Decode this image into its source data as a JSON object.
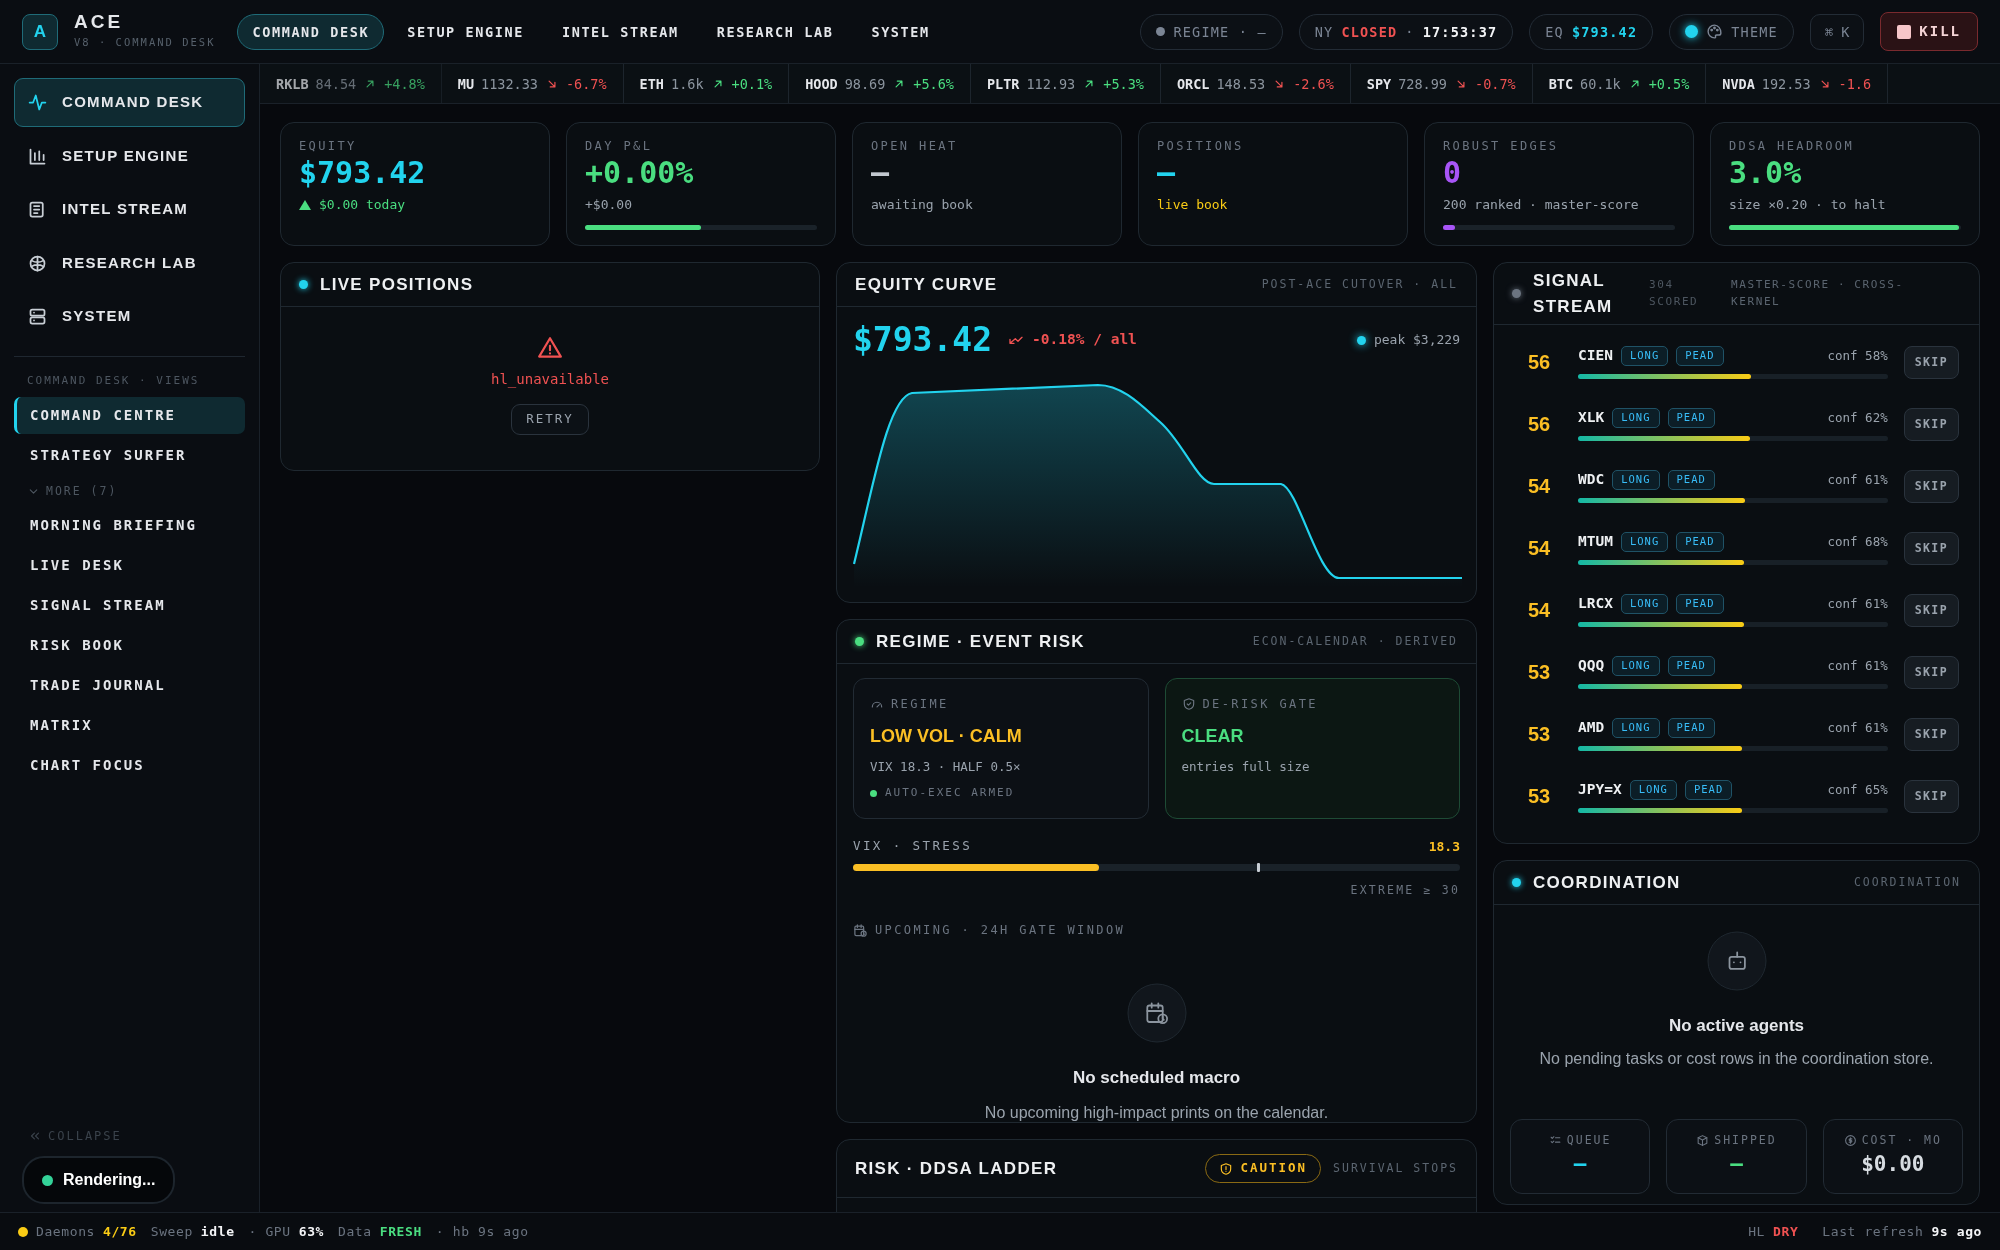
{
  "brand": {
    "logo": "A",
    "name": "ACE",
    "subtitle": "V8 · COMMAND DESK"
  },
  "top_nav": [
    {
      "label": "COMMAND DESK",
      "selected": true
    },
    {
      "label": "SETUP ENGINE",
      "selected": false
    },
    {
      "label": "INTEL STREAM",
      "selected": false
    },
    {
      "label": "RESEARCH LAB",
      "selected": false
    },
    {
      "label": "SYSTEM",
      "selected": false
    }
  ],
  "top_status": {
    "regime": {
      "label": "REGIME · —",
      "color": "#7b8594"
    },
    "market": {
      "city": "NY",
      "session": "CLOSED",
      "separator": "·",
      "time": "17:53:37"
    },
    "equity": {
      "label": "EQ",
      "value": "$793.42"
    },
    "theme": {
      "label": "THEME",
      "color": "#22d3ee"
    },
    "shortcut": {
      "label": "⌘ K"
    },
    "kill": {
      "label": "KILL"
    }
  },
  "ticker": [
    {
      "symbol": "RKLB",
      "price": "84.54",
      "change": "+4.8%",
      "rising": true
    },
    {
      "symbol": "MU",
      "price": "1132.33",
      "change": "-6.7%",
      "rising": false
    },
    {
      "symbol": "ETH",
      "price": "1.6k",
      "change": "+0.1%",
      "rising": true
    },
    {
      "symbol": "HOOD",
      "price": "98.69",
      "change": "+5.6%",
      "rising": true
    },
    {
      "symbol": "PLTR",
      "price": "112.93",
      "change": "+5.3%",
      "rising": true
    },
    {
      "symbol": "ORCL",
      "price": "148.53",
      "change": "-2.6%",
      "rising": false
    },
    {
      "symbol": "SPY",
      "price": "728.99",
      "change": "-0.7%",
      "rising": false
    },
    {
      "symbol": "BTC",
      "price": "60.1k",
      "change": "+0.5%",
      "rising": true
    },
    {
      "symbol": "NVDA",
      "price": "192.53",
      "change": "-1.6",
      "rising": false
    }
  ],
  "sidebar": {
    "items": [
      {
        "label": "COMMAND DESK",
        "selected": true
      },
      {
        "label": "SETUP ENGINE",
        "selected": false
      },
      {
        "label": "INTEL STREAM",
        "selected": false
      },
      {
        "label": "RESEARCH LAB",
        "selected": false
      },
      {
        "label": "SYSTEM",
        "selected": false
      }
    ],
    "views_heading": "COMMAND DESK · VIEWS",
    "views": [
      {
        "label": "COMMAND CENTRE",
        "selected": true
      },
      {
        "label": "STRATEGY SURFER",
        "selected": false
      }
    ],
    "more": {
      "label": "MORE (7)",
      "expanded": true,
      "items": [
        {
          "label": "MORNING BRIEFING",
          "selected": false
        },
        {
          "label": "LIVE DESK",
          "selected": false
        },
        {
          "label": "SIGNAL STREAM",
          "selected": false
        },
        {
          "label": "RISK BOOK",
          "selected": false
        },
        {
          "label": "TRADE JOURNAL",
          "selected": false
        },
        {
          "label": "MATRIX",
          "selected": false
        },
        {
          "label": "CHART FOCUS",
          "selected": false
        }
      ]
    },
    "collapse": "COLLAPSE"
  },
  "toast": {
    "label": "Rendering...",
    "color": "#34d399"
  },
  "kpis": [
    {
      "label": "EQUITY",
      "value": "$793.42",
      "color": "#22d3ee",
      "rising": true,
      "sub": {
        "text": "$0.00 today",
        "color": "#4ade80"
      }
    },
    {
      "label": "DAY P&L",
      "value": "+0.00%",
      "color": "#4ade80",
      "sub": {
        "text": "+$0.00",
        "color": "#9aa3ad"
      },
      "level": 0.5
    },
    {
      "label": "OPEN HEAT",
      "value": "—",
      "color": "#c2c8cf",
      "sub": {
        "text": "awaiting book",
        "color": "#9aa3ad"
      }
    },
    {
      "label": "POSITIONS",
      "value": "—",
      "color": "#22d3ee",
      "sub": {
        "text": "live book",
        "color": "#facc15"
      }
    },
    {
      "label": "ROBUST EDGES",
      "value": "0",
      "color": "#a855f7",
      "sub": {
        "text": "200 ranked · master-score",
        "color": "#9aa3ad"
      },
      "level": 0.05
    },
    {
      "label": "DDSA HEADROOM",
      "value": "3.0%",
      "color": "#4ade80",
      "sub": {
        "text": "size ×0.20 · to halt",
        "color": "#9aa3ad"
      },
      "level": 0.99
    }
  ],
  "live_positions": {
    "title": "LIVE POSITIONS",
    "color": "#22d3ee",
    "error": "hl_unavailable",
    "action": "RETRY"
  },
  "equity_curve": {
    "title": "EQUITY CURVE",
    "meta": "POST-ACE CUTOVER · ALL",
    "value": "$793.42",
    "change": "-0.18% / all",
    "peak": "peak $3,229"
  },
  "regime_panel": {
    "title": "REGIME · EVENT RISK",
    "color": "#4ade80",
    "meta": "ECON-CALENDAR · DERIVED",
    "regime": {
      "label": "REGIME",
      "value": "LOW VOL · CALM",
      "detail": "VIX 18.3 · HALF 0.5×",
      "armed": "AUTO-EXEC ARMED"
    },
    "gate": {
      "label": "DE-RISK GATE",
      "value": "CLEAR",
      "detail": "entries full size"
    },
    "vix": {
      "label": "VIX · STRESS",
      "value": "18.3",
      "level": 0.405,
      "threshold": "EXTREME ≥ 30"
    },
    "upcoming": {
      "label": "UPCOMING · 24H GATE WINDOW",
      "empty_title": "No scheduled macro",
      "empty_text": "No upcoming high-impact prints on the calendar."
    }
  },
  "risk_panel": {
    "title": "RISK · DDSA LADDER",
    "badge": "CAUTION",
    "meta": "SURVIVAL STOPS"
  },
  "signal_stream": {
    "title": "SIGNAL STREAM",
    "color": "#6b7480",
    "count": "304 SCORED",
    "meta": "MASTER-SCORE · CROSS-KERNEL",
    "rows": [
      {
        "score": "56",
        "symbol": "CIEN",
        "tags": [
          "LONG",
          "PEAD"
        ],
        "conf": "conf 58%",
        "level": 0.56,
        "action": "SKIP"
      },
      {
        "score": "56",
        "symbol": "XLK",
        "tags": [
          "LONG",
          "PEAD"
        ],
        "conf": "conf 62%",
        "level": 0.555,
        "action": "SKIP"
      },
      {
        "score": "54",
        "symbol": "WDC",
        "tags": [
          "LONG",
          "PEAD"
        ],
        "conf": "conf 61%",
        "level": 0.54,
        "action": "SKIP"
      },
      {
        "score": "54",
        "symbol": "MTUM",
        "tags": [
          "LONG",
          "PEAD"
        ],
        "conf": "conf 68%",
        "level": 0.535,
        "action": "SKIP"
      },
      {
        "score": "54",
        "symbol": "LRCX",
        "tags": [
          "LONG",
          "PEAD"
        ],
        "conf": "conf 61%",
        "level": 0.535,
        "action": "SKIP"
      },
      {
        "score": "53",
        "symbol": "QQQ",
        "tags": [
          "LONG",
          "PEAD"
        ],
        "conf": "conf 61%",
        "level": 0.53,
        "action": "SKIP"
      },
      {
        "score": "53",
        "symbol": "AMD",
        "tags": [
          "LONG",
          "PEAD"
        ],
        "conf": "conf 61%",
        "level": 0.53,
        "action": "SKIP"
      },
      {
        "score": "53",
        "symbol": "JPY=X",
        "tags": [
          "LONG",
          "PEAD"
        ],
        "conf": "conf 65%",
        "level": 0.53,
        "action": "SKIP"
      }
    ]
  },
  "coordination": {
    "title": "COORDINATION",
    "color": "#22d3ee",
    "meta": "COORDINATION",
    "empty_title": "No active agents",
    "empty_text": "No pending tasks or cost rows in the coordination store.",
    "stats": [
      {
        "label": "QUEUE",
        "value": "—",
        "color": "#22d3ee"
      },
      {
        "label": "SHIPPED",
        "value": "—",
        "color": "#4ade80"
      },
      {
        "label": "COST · MO",
        "value": "$0.00",
        "color": "#d7dce1"
      }
    ]
  },
  "status_bar": {
    "daemon_dot": {
      "color": "#facc15"
    },
    "items": [
      {
        "label": "Daemons",
        "value": "4/76",
        "color": "#facc15"
      },
      {
        "label": "Sweep",
        "value": "idle",
        "color": "#f3f4f6"
      },
      {
        "label": "· GPU",
        "value": "63%",
        "color": "#f3f4f6"
      },
      {
        "label": "Data",
        "value": "FRESH",
        "color": "#4ade80"
      },
      {
        "label": "· hb 9s ago"
      }
    ],
    "right": [
      {
        "label": "HL",
        "value": "DRY",
        "color": "#f05252"
      },
      {
        "label": "Last refresh",
        "value": "9s ago",
        "color": "#f3f4f6"
      }
    ]
  }
}
